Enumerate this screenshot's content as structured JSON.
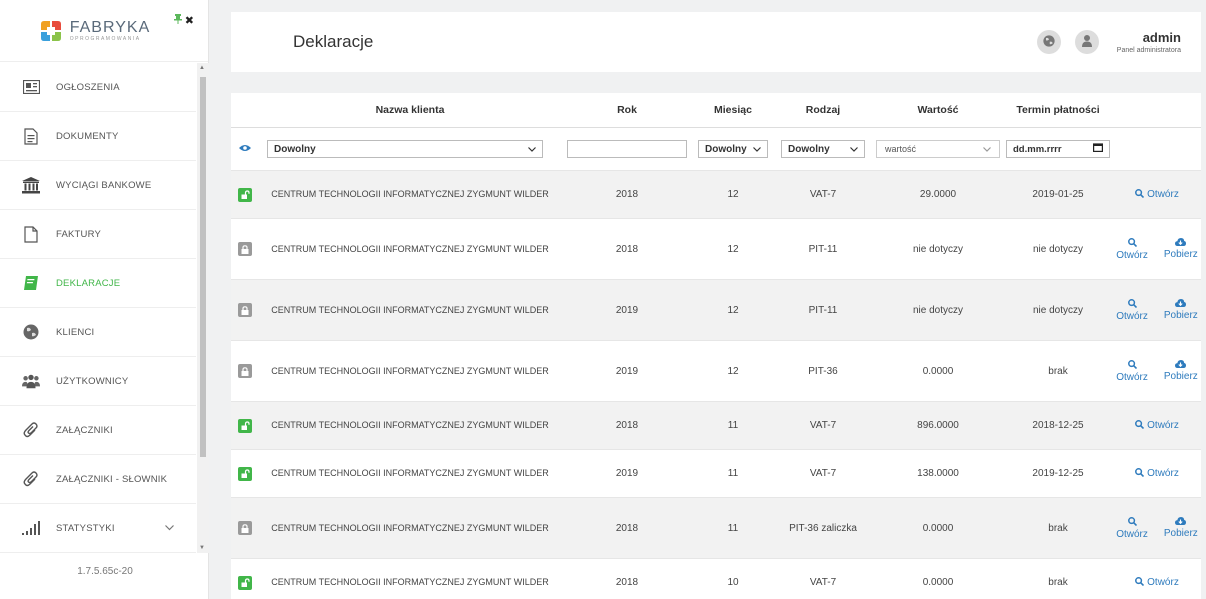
{
  "app": {
    "logo_name": "FABRYKA",
    "logo_sub": "OPROGRAMOWANIA",
    "version": "1.7.5.65c-20"
  },
  "sidebar": {
    "items": [
      {
        "label": "OGŁOSZENIA",
        "icon": "newspaper-icon",
        "active": false
      },
      {
        "label": "DOKUMENTY",
        "icon": "document-icon",
        "active": false
      },
      {
        "label": "WYCIĄGI BANKOWE",
        "icon": "bank-icon",
        "active": false
      },
      {
        "label": "FAKTURY",
        "icon": "file-icon",
        "active": false
      },
      {
        "label": "DEKLARACJE",
        "icon": "book-icon",
        "active": true
      },
      {
        "label": "KLIENCI",
        "icon": "globe-icon",
        "active": false
      },
      {
        "label": "UŻYTKOWNICY",
        "icon": "users-icon",
        "active": false
      },
      {
        "label": "ZAŁĄCZNIKI",
        "icon": "paperclip-icon",
        "active": false
      },
      {
        "label": "ZAŁĄCZNIKI - SŁOWNIK",
        "icon": "paperclip-icon",
        "active": false
      },
      {
        "label": "STATYSTYKI",
        "icon": "bar-chart-icon",
        "active": false
      }
    ]
  },
  "header": {
    "title": "Deklaracje",
    "user_name": "admin",
    "user_role": "Panel administratora"
  },
  "table": {
    "columns": {
      "client": "Nazwa klienta",
      "year": "Rok",
      "month": "Miesiąc",
      "type": "Rodzaj",
      "value": "Wartość",
      "due": "Termin płatności"
    },
    "filters": {
      "client": "Dowolny",
      "month": "Dowolny",
      "type": "Dowolny",
      "value_placeholder": "wartość",
      "date_placeholder": "dd.mm.rrrr"
    },
    "actions": {
      "open": "Otwórz",
      "download": "Pobierz"
    },
    "rows": [
      {
        "client": "CENTRUM TECHNOLOGII INFORMATYCZNEJ ZYGMUNT WILDER",
        "year": "2018",
        "month": "12",
        "type": "VAT-7",
        "value": "29.0000",
        "due": "2019-01-25"
      },
      {
        "client": "CENTRUM TECHNOLOGII INFORMATYCZNEJ ZYGMUNT WILDER",
        "year": "2018",
        "month": "12",
        "type": "PIT-11",
        "value": "nie dotyczy",
        "due": "nie dotyczy"
      },
      {
        "client": "CENTRUM TECHNOLOGII INFORMATYCZNEJ ZYGMUNT WILDER",
        "year": "2019",
        "month": "12",
        "type": "PIT-11",
        "value": "nie dotyczy",
        "due": "nie dotyczy"
      },
      {
        "client": "CENTRUM TECHNOLOGII INFORMATYCZNEJ ZYGMUNT WILDER",
        "year": "2019",
        "month": "12",
        "type": "PIT-36",
        "value": "0.0000",
        "due": "brak"
      },
      {
        "client": "CENTRUM TECHNOLOGII INFORMATYCZNEJ ZYGMUNT WILDER",
        "year": "2018",
        "month": "11",
        "type": "VAT-7",
        "value": "896.0000",
        "due": "2018-12-25"
      },
      {
        "client": "CENTRUM TECHNOLOGII INFORMATYCZNEJ ZYGMUNT WILDER",
        "year": "2019",
        "month": "11",
        "type": "VAT-7",
        "value": "138.0000",
        "due": "2019-12-25"
      },
      {
        "client": "CENTRUM TECHNOLOGII INFORMATYCZNEJ ZYGMUNT WILDER",
        "year": "2018",
        "month": "11",
        "type": "PIT-36 zaliczka",
        "value": "0.0000",
        "due": "brak"
      },
      {
        "client": "CENTRUM TECHNOLOGII INFORMATYCZNEJ ZYGMUNT WILDER",
        "year": "2018",
        "month": "10",
        "type": "VAT-7",
        "value": "0.0000",
        "due": "brak"
      }
    ]
  },
  "colors": {
    "accent_green": "#41b649",
    "link_blue": "#2e7bbd",
    "badge_gray": "#9a9a9a"
  }
}
